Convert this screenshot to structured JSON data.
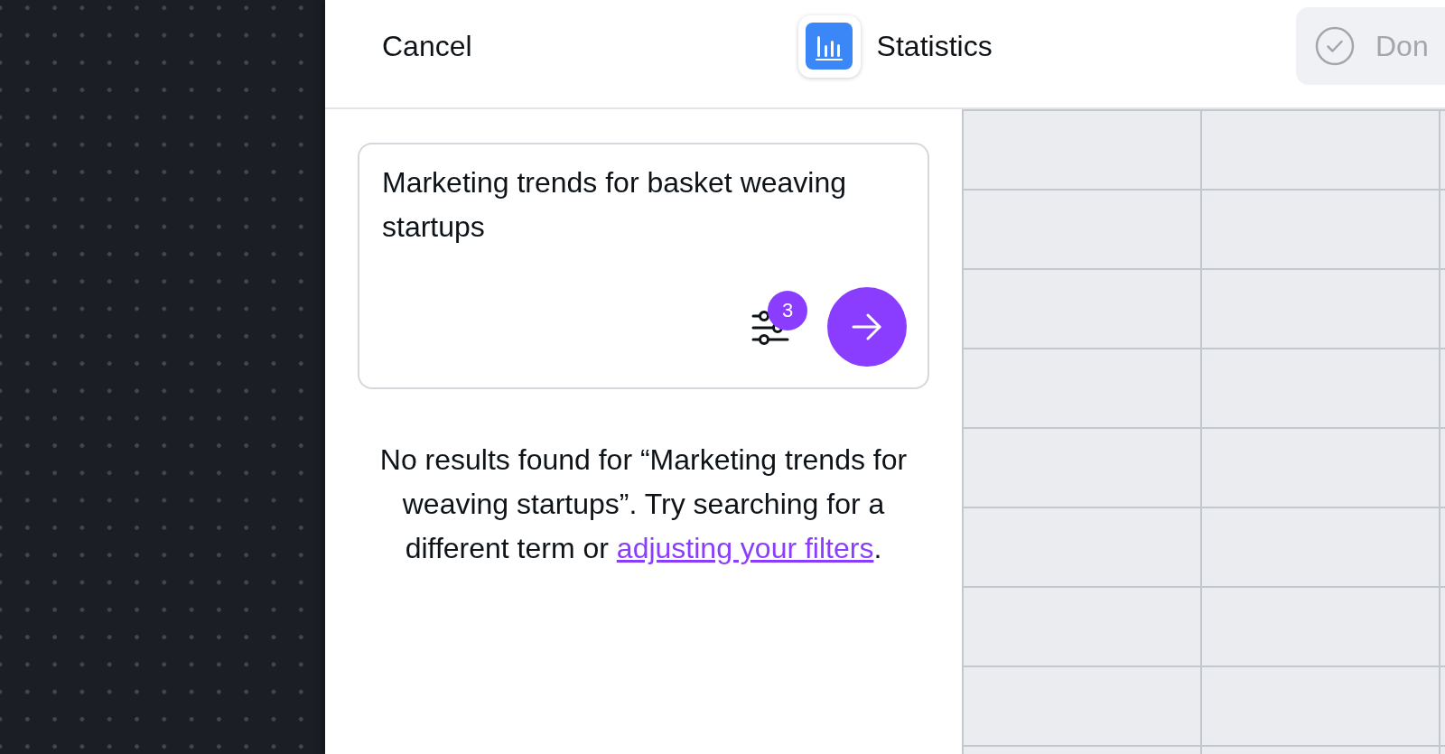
{
  "header": {
    "cancel_label": "Cancel",
    "app_title": "Statistics",
    "done_button": {
      "label": "Don",
      "disabled": true
    }
  },
  "search": {
    "value": "Marketing trends for basket weaving startups",
    "filter_count": "3"
  },
  "message": {
    "text": "No results found for “Marketing trends for weaving startups”. Try searching for a different term or ",
    "link": "adjusting your filters",
    "text_end": "."
  }
}
